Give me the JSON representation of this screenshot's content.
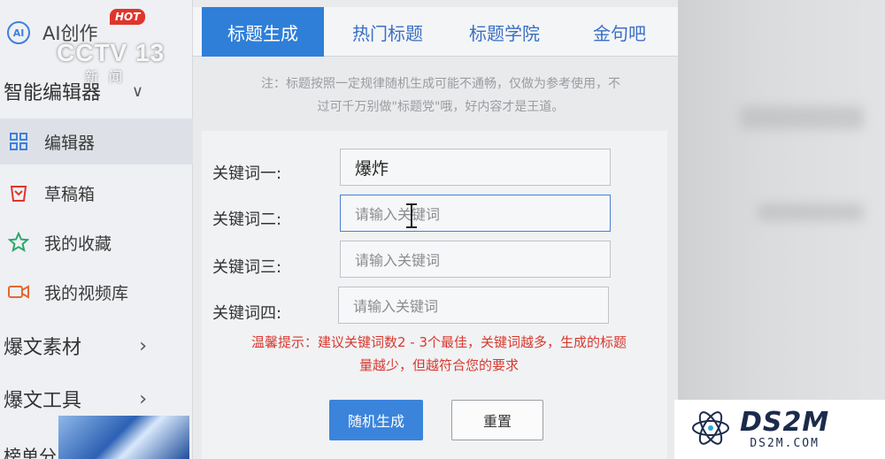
{
  "sidebar": {
    "ai_item": {
      "label": "AI创作",
      "badge": "HOT",
      "icon": "ai-icon"
    },
    "group_editor": {
      "label": "智能编辑器",
      "chevron": "∨"
    },
    "items": [
      {
        "label": "编辑器",
        "icon": "grid-icon",
        "active": true
      },
      {
        "label": "草稿箱",
        "icon": "trash-bin-icon",
        "active": false
      },
      {
        "label": "我的收藏",
        "icon": "star-icon",
        "active": false
      },
      {
        "label": "我的视频库",
        "icon": "video-camera-icon",
        "active": false
      }
    ],
    "group_material": {
      "label": "爆文素材",
      "chevron": "›"
    },
    "group_tools": {
      "label": "爆文工具",
      "chevron": "›"
    },
    "group_cut": {
      "label": "榜单分"
    }
  },
  "overlay": {
    "channel_logo": "CCTV 13",
    "channel_sub": "新闻"
  },
  "tabs": [
    {
      "label": "标题生成",
      "active": true
    },
    {
      "label": "热门标题",
      "active": false
    },
    {
      "label": "标题学院",
      "active": false
    },
    {
      "label": "金句吧",
      "active": false
    }
  ],
  "note": {
    "line1": "注：标题按照一定规律随机生成可能不通畅，仅做为参考使用，不",
    "line2": "过可千万别做\"标题党\"哦，好内容才是王道。"
  },
  "form": {
    "rows": [
      {
        "label": "关键词一:",
        "value": "爆炸",
        "placeholder": "请输入关键词"
      },
      {
        "label": "关键词二:",
        "value": "",
        "placeholder": "请输入关键词"
      },
      {
        "label": "关键词三:",
        "value": "",
        "placeholder": "请输入关键词"
      },
      {
        "label": "关键词四:",
        "value": "",
        "placeholder": "请输入关键词"
      }
    ],
    "tip_line1": "温馨提示：建议关键词数2 - 3个最佳，关键词越多，生成的标题",
    "tip_line2": "量越少，但越符合您的要求",
    "generate_label": "随机生成",
    "reset_label": "重置"
  },
  "watermark": {
    "title": "DS2M",
    "subtitle": "DS2M.COM"
  },
  "colors": {
    "accent": "#2f7fd8",
    "tip": "#d8392f",
    "hot": "#e0352b"
  }
}
